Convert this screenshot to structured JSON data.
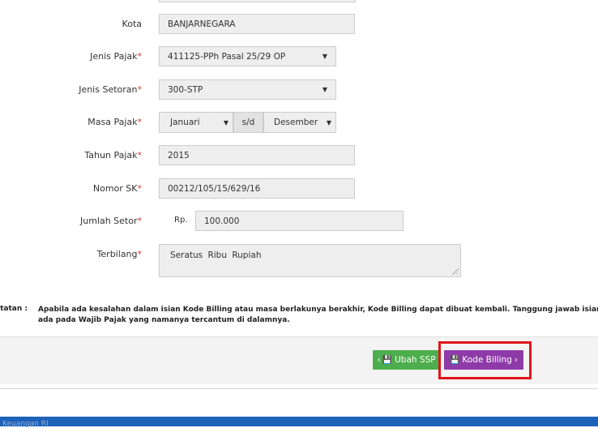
{
  "form": {
    "kota": {
      "label": "Kota",
      "value": "BANJARNEGARA"
    },
    "jenis_pajak": {
      "label": "Jenis Pajak",
      "required": "*",
      "value": "411125-PPh Pasal 25/29 OP"
    },
    "jenis_setoran": {
      "label": "Jenis Setoran",
      "required": "*",
      "value": "300-STP"
    },
    "masa_pajak": {
      "label": "Masa Pajak",
      "required": "*",
      "from": "Januari",
      "separator": "s/d",
      "to": "Desember"
    },
    "tahun_pajak": {
      "label": "Tahun Pajak",
      "required": "*",
      "value": "2015"
    },
    "nomor_sk": {
      "label": "Nomor SK",
      "required": "*",
      "value": "00212/105/15/629/16"
    },
    "jumlah_setor": {
      "label": "Jumlah Setor",
      "required": "*",
      "currency": "Rp.",
      "value": "100.000"
    },
    "terbilang": {
      "label": "Terbilang",
      "required": "*",
      "value": "Seratus Ribu Rupiah"
    }
  },
  "notes": {
    "label": "atatan :",
    "line1": "Apabila ada kesalahan dalam isian Kode Billing atau masa berlakunya berakhir, Kode Billing dapat dibuat kembali. Tanggung jawab isian Kode",
    "line2": "ada pada Wajib Pajak yang namanya tercantum di dalamnya."
  },
  "buttons": {
    "ubah_ssp": {
      "prefix": "‹",
      "icon": "save-icon",
      "label": "Ubah SSP"
    },
    "kode_billing": {
      "icon": "save-icon",
      "label": "Kode Billing",
      "suffix": "›"
    }
  },
  "footer": {
    "text": "Keuangan RI"
  },
  "colors": {
    "green_button": "#4cae4c",
    "purple_button": "#8e3aa8",
    "highlight": "#e0141a",
    "footer_bar": "#1d61b8"
  }
}
